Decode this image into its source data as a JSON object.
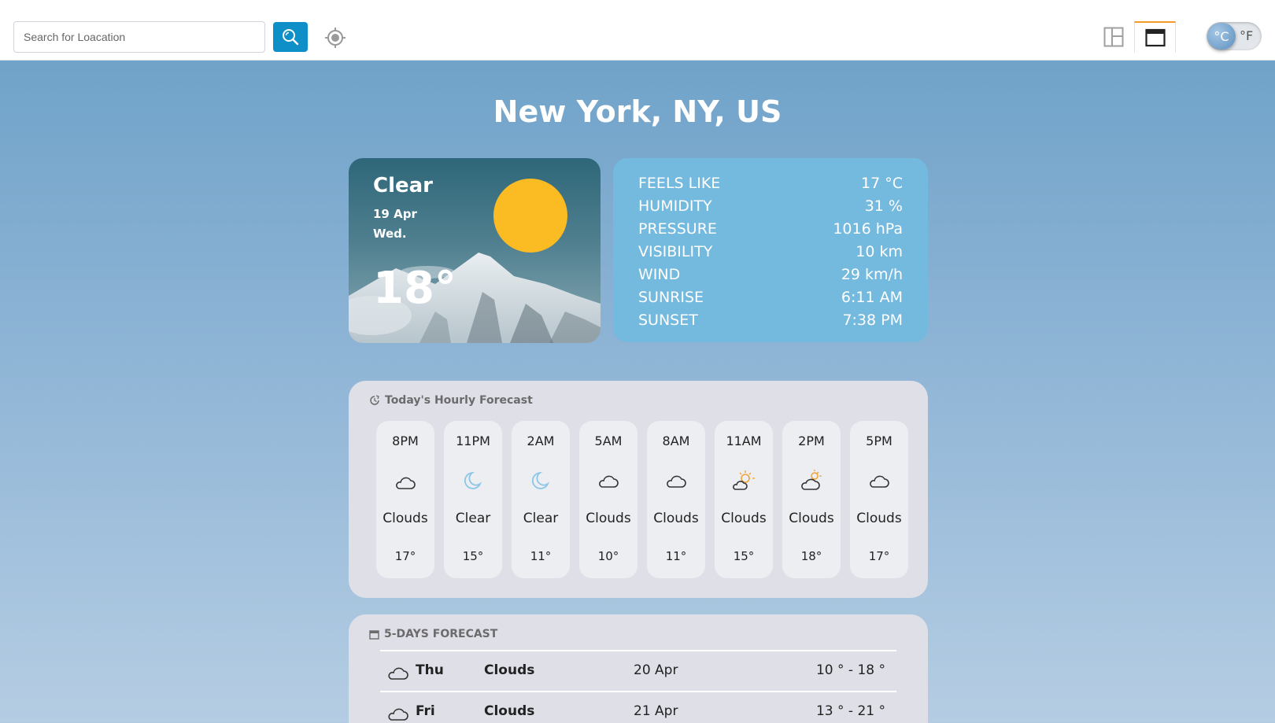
{
  "header": {
    "search_placeholder": "Search for Loacation",
    "search_icon": "magnifier-icon",
    "locate_icon": "crosshair-icon",
    "view_split_icon": "split-layout-icon",
    "view_full_icon": "full-window-icon",
    "unit_celsius": "°C",
    "unit_fahrenheit": "°F",
    "accent_color": "#0f8fc7"
  },
  "location": "New York, NY, US",
  "current": {
    "condition": "Clear",
    "date": "19 Apr",
    "weekday": "Wed.",
    "temperature": "18°"
  },
  "details": [
    {
      "label": "FEELS LIKE",
      "value": "17 °C"
    },
    {
      "label": "HUMIDITY",
      "value": "31 %"
    },
    {
      "label": "PRESSURE",
      "value": "1016 hPa"
    },
    {
      "label": "VISIBILITY",
      "value": "10 km"
    },
    {
      "label": "WIND",
      "value": "29 km/h"
    },
    {
      "label": "SUNRISE",
      "value": "6:11 AM"
    },
    {
      "label": "SUNSET",
      "value": "7:38 PM"
    }
  ],
  "hourly": {
    "title": "Today's Hourly Forecast",
    "items": [
      {
        "time": "8PM",
        "icon": "cloud-moon-icon",
        "desc": "Clouds",
        "temp": "17°"
      },
      {
        "time": "11PM",
        "icon": "moon-icon",
        "desc": "Clear",
        "temp": "15°"
      },
      {
        "time": "2AM",
        "icon": "moon-icon",
        "desc": "Clear",
        "temp": "11°"
      },
      {
        "time": "5AM",
        "icon": "cloud-icon",
        "desc": "Clouds",
        "temp": "10°"
      },
      {
        "time": "8AM",
        "icon": "cloud-icon",
        "desc": "Clouds",
        "temp": "11°"
      },
      {
        "time": "11AM",
        "icon": "cloud-sun-icon",
        "desc": "Clouds",
        "temp": "15°"
      },
      {
        "time": "2PM",
        "icon": "cloud-sun-icon",
        "desc": "Clouds",
        "temp": "18°"
      },
      {
        "time": "5PM",
        "icon": "cloud-icon",
        "desc": "Clouds",
        "temp": "17°"
      }
    ]
  },
  "forecast": {
    "title": "5-DAYS FORECAST",
    "days": [
      {
        "day": "Thu",
        "cond": "Clouds",
        "date": "20 Apr",
        "range": "10 ° - 18 °",
        "icon": "cloud-icon"
      },
      {
        "day": "Fri",
        "cond": "Clouds",
        "date": "21 Apr",
        "range": "13 ° - 21 °",
        "icon": "cloud-icon"
      }
    ]
  }
}
